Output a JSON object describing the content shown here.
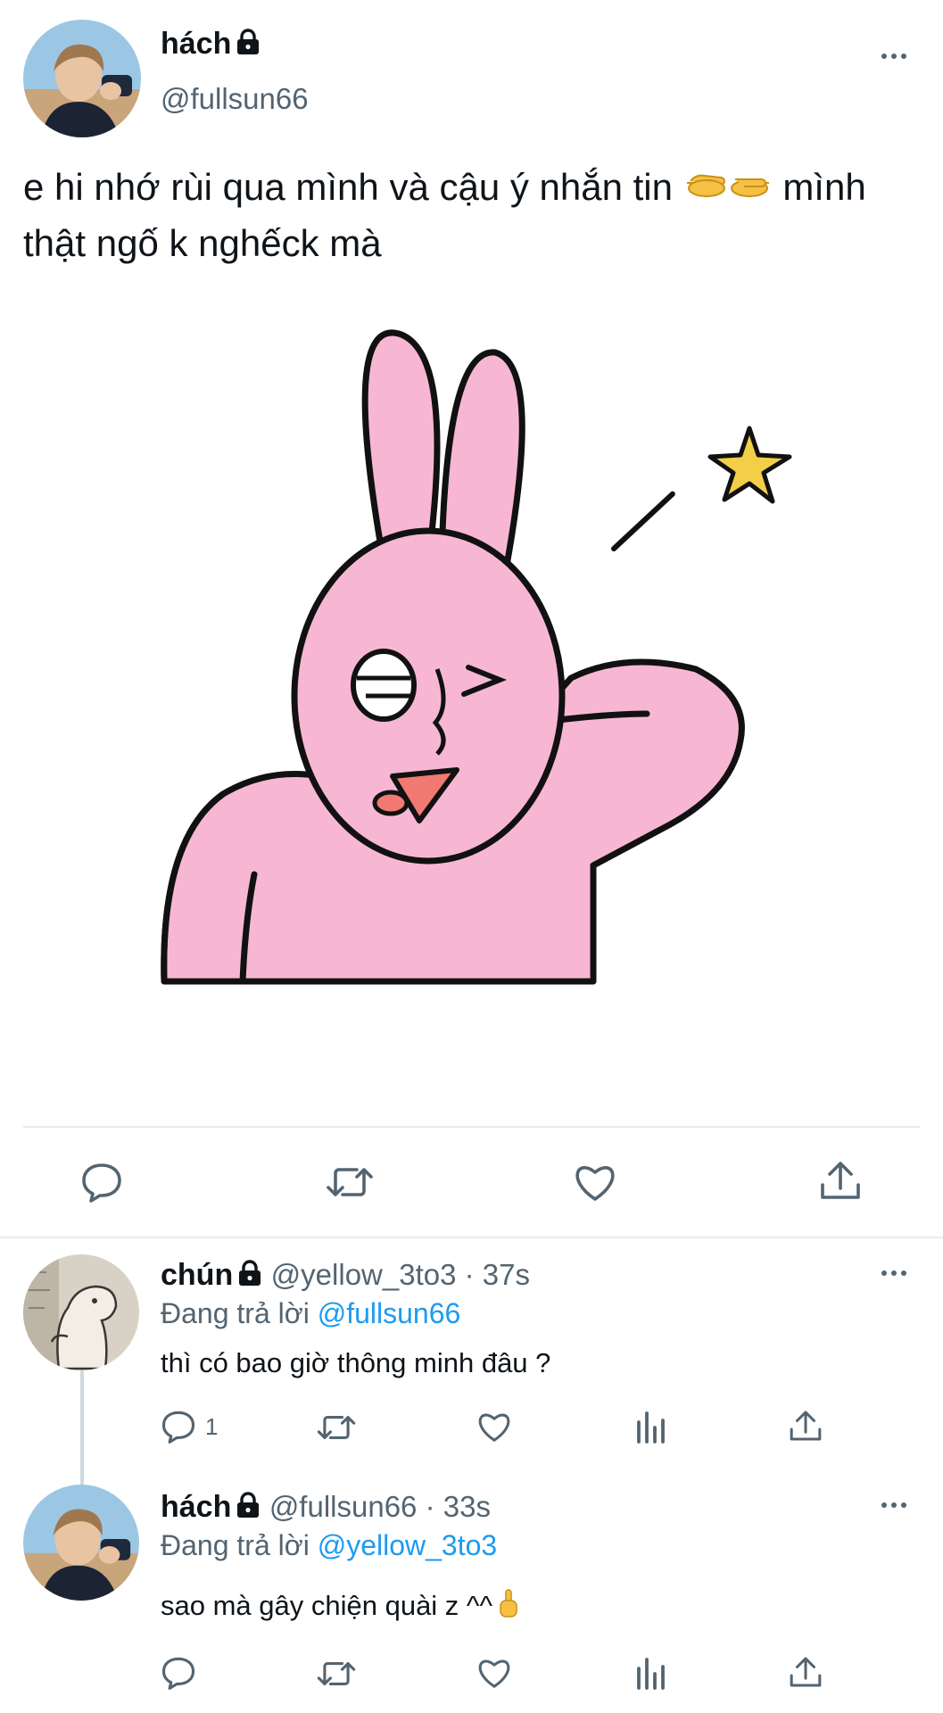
{
  "main_tweet": {
    "author_name": "hách",
    "author_handle": "@fullsun66",
    "text_part1": "e hi nhớ rùi qua mình và cậu ý nhắn tin ",
    "text_part2": " mình thật ngố k nghếck mà",
    "more_icon": "more-horizontal-icon",
    "media_icon": "pink-rabbit-sticker",
    "actions": {
      "reply_icon": "reply-icon",
      "retweet_icon": "retweet-icon",
      "like_icon": "heart-icon",
      "share_icon": "share-icon"
    }
  },
  "replies": [
    {
      "author_name": "chún",
      "author_handle": "@yellow_3to3",
      "time": " · 37s",
      "replying_prefix": "Đang trả lời ",
      "replying_to": "@fullsun66",
      "text": "thì có bao giờ thông minh đâu ?",
      "reply_count": "1"
    },
    {
      "author_name": "hách",
      "author_handle": "@fullsun66",
      "time": " · 33s",
      "replying_prefix": "Đang trả lời ",
      "replying_to": "@yellow_3to3",
      "text": "sao mà gây chiện quài z ^^",
      "reply_count": ""
    }
  ],
  "colors": {
    "accent": "#1d9bf0",
    "secondary_text": "#536471",
    "rabbit_pink": "#f7b7d3"
  }
}
